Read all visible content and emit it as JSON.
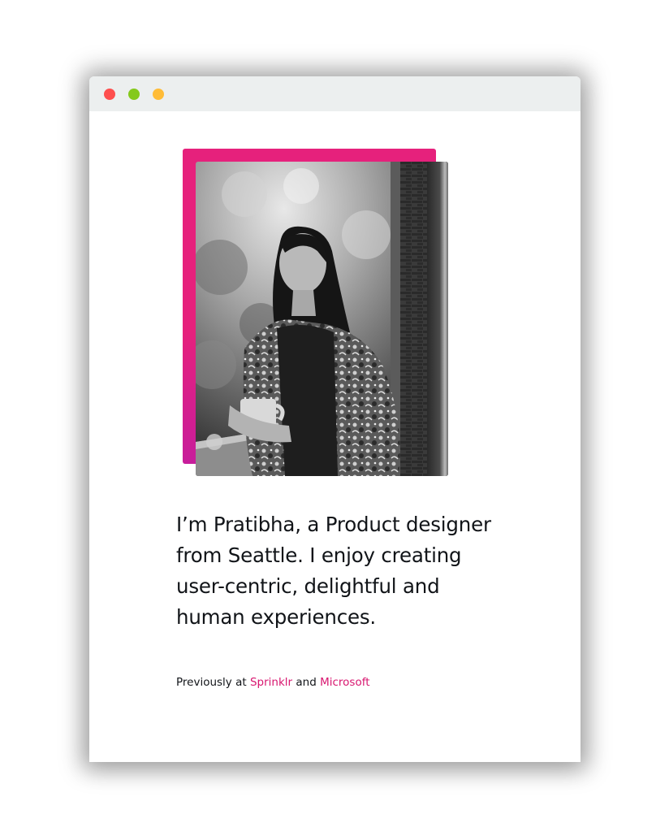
{
  "window": {
    "controls": [
      {
        "name": "close",
        "color": "#fe4f4e"
      },
      {
        "name": "maximize",
        "color": "#84c91b"
      },
      {
        "name": "minimize",
        "color": "#ffbc37"
      }
    ]
  },
  "hero": {
    "photo_icon": "portrait-photo",
    "accent_gradient": [
      "#e6217c",
      "#b21bb0"
    ],
    "headline": "I’m Pratibha, a Product designer from Seattle. I enjoy creating user-centric, delightful and human experiences.",
    "previously_prefix": "Previously at",
    "company_1": "Sprinklr",
    "conjunction": "and",
    "company_2": "Microsoft",
    "link_color": "#d8166f"
  }
}
